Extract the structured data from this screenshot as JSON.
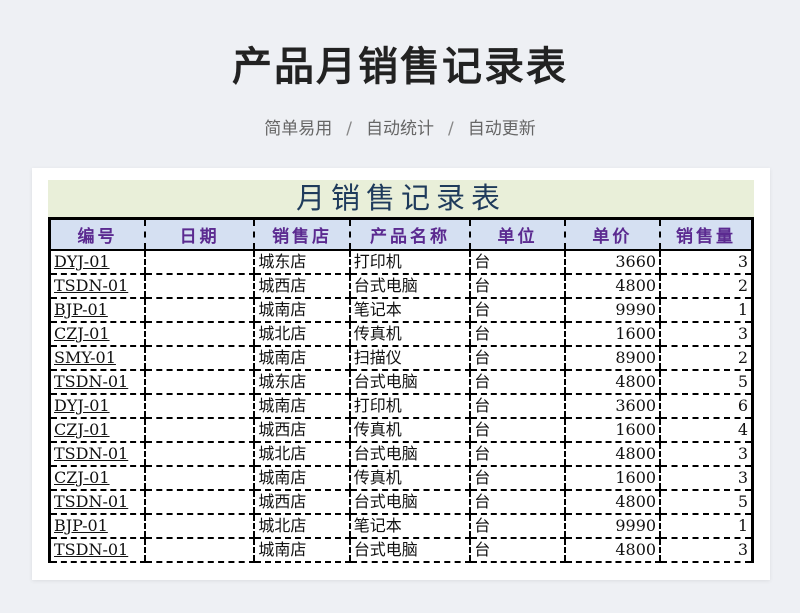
{
  "header": {
    "title": "产品月销售记录表",
    "tags": [
      "简单易用",
      "自动统计",
      "自动更新"
    ],
    "separator": "/"
  },
  "sheet": {
    "title": "月销售记录表",
    "columns": [
      "编号",
      "日期",
      "销售店",
      "产品名称",
      "单位",
      "单价",
      "销售量"
    ],
    "rows": [
      [
        "DYJ-01",
        "",
        "城东店",
        "打印机",
        "台",
        "3660",
        "3"
      ],
      [
        "TSDN-01",
        "",
        "城西店",
        "台式电脑",
        "台",
        "4800",
        "2"
      ],
      [
        "BJP-01",
        "",
        "城南店",
        "笔记本",
        "台",
        "9990",
        "1"
      ],
      [
        "CZJ-01",
        "",
        "城北店",
        "传真机",
        "台",
        "1600",
        "3"
      ],
      [
        "SMY-01",
        "",
        "城南店",
        "扫描仪",
        "台",
        "8900",
        "2"
      ],
      [
        "TSDN-01",
        "",
        "城东店",
        "台式电脑",
        "台",
        "4800",
        "5"
      ],
      [
        "DYJ-01",
        "",
        "城南店",
        "打印机",
        "台",
        "3600",
        "6"
      ],
      [
        "CZJ-01",
        "",
        "城西店",
        "传真机",
        "台",
        "1600",
        "4"
      ],
      [
        "TSDN-01",
        "",
        "城北店",
        "台式电脑",
        "台",
        "4800",
        "3"
      ],
      [
        "CZJ-01",
        "",
        "城南店",
        "传真机",
        "台",
        "1600",
        "3"
      ],
      [
        "TSDN-01",
        "",
        "城西店",
        "台式电脑",
        "台",
        "4800",
        "5"
      ],
      [
        "BJP-01",
        "",
        "城北店",
        "笔记本",
        "台",
        "9990",
        "1"
      ],
      [
        "TSDN-01",
        "",
        "城南店",
        "台式电脑",
        "台",
        "4800",
        "3"
      ]
    ]
  }
}
